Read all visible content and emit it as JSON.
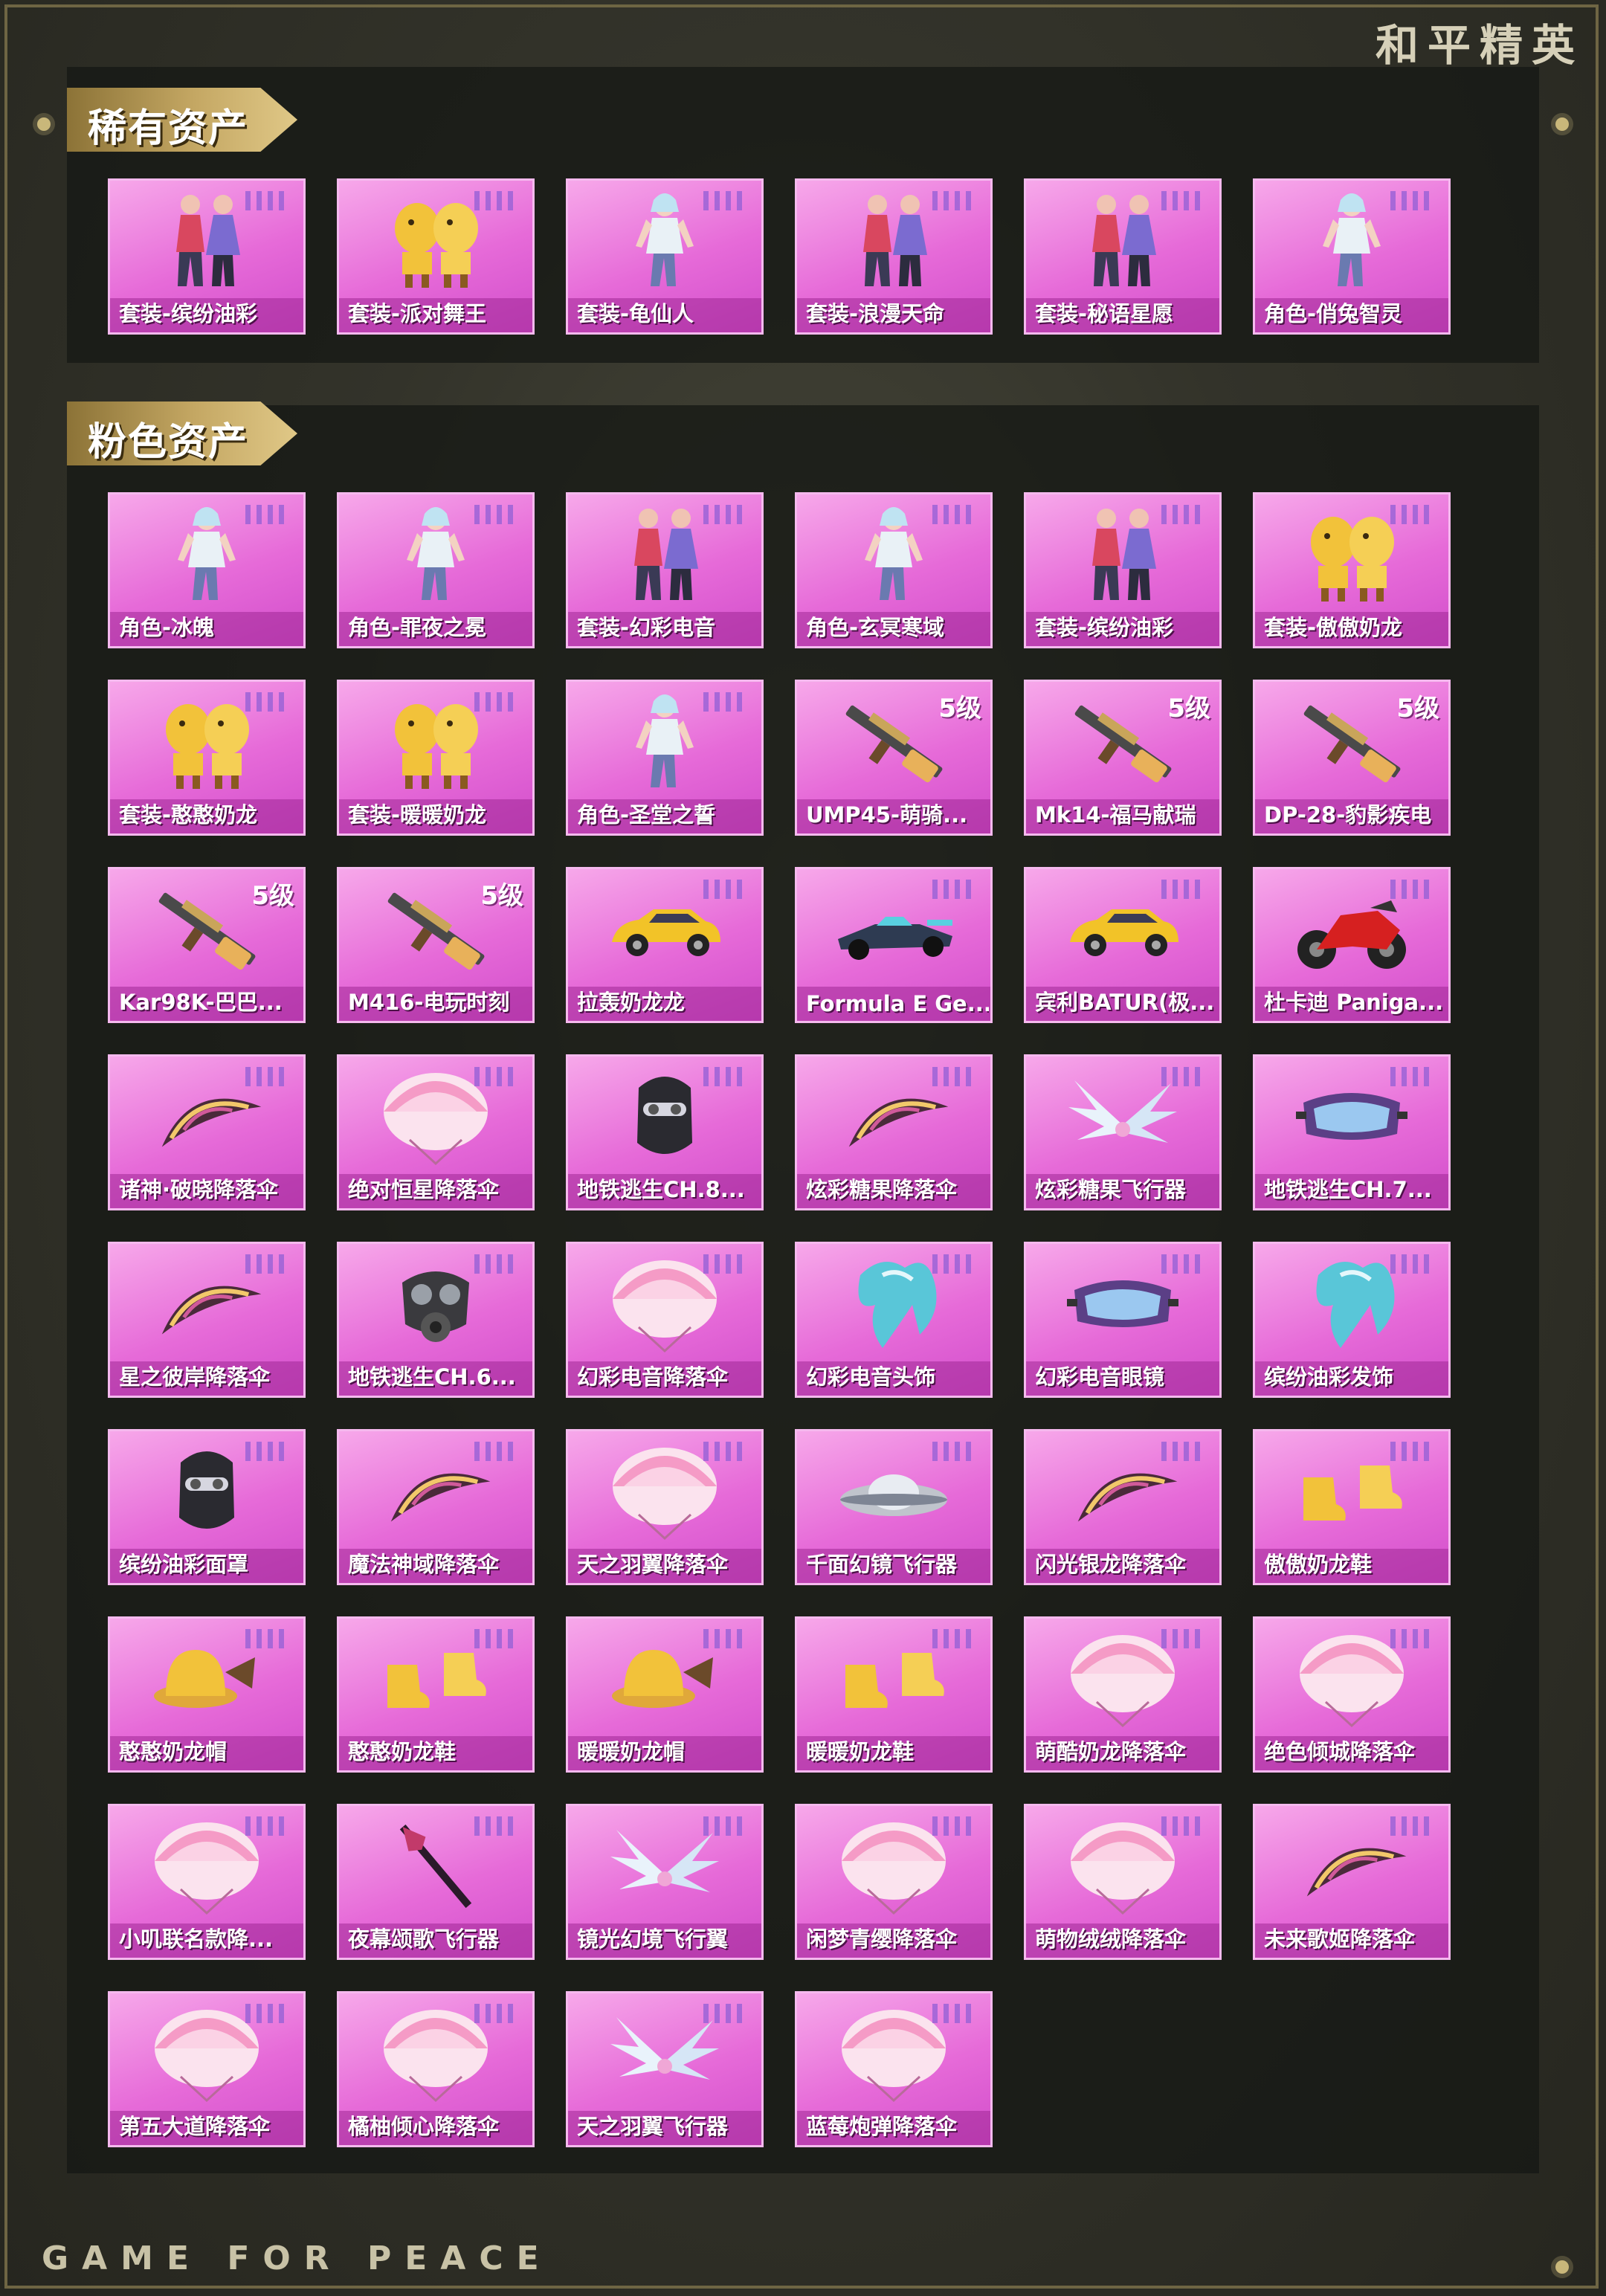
{
  "header": {
    "brand": "和平精英"
  },
  "footer": {
    "brand": "GAME FOR PEACE"
  },
  "colors": {
    "card_bg": "#e66ad8",
    "card_border": "#f5b9ee",
    "section_banner": "#c4a763",
    "panel_bg": "#161814"
  },
  "sections": {
    "rare": {
      "title": "稀有资产",
      "items": [
        {
          "label": "套装-缤纷油彩",
          "icon": "outfit-pair",
          "tier": ""
        },
        {
          "label": "套装-派对舞王",
          "icon": "golden-outfit",
          "tier": ""
        },
        {
          "label": "套装-龟仙人",
          "icon": "character",
          "tier": ""
        },
        {
          "label": "套装-浪漫天命",
          "icon": "outfit-pair",
          "tier": ""
        },
        {
          "label": "套装-秘语星愿",
          "icon": "outfit-pair",
          "tier": ""
        },
        {
          "label": "角色-俏兔智灵",
          "icon": "character",
          "tier": ""
        }
      ]
    },
    "pink": {
      "title": "粉色资产",
      "items": [
        {
          "label": "角色-冰魄",
          "icon": "character",
          "tier": ""
        },
        {
          "label": "角色-罪夜之冕",
          "icon": "character",
          "tier": ""
        },
        {
          "label": "套装-幻彩电音",
          "icon": "outfit-pair",
          "tier": ""
        },
        {
          "label": "角色-玄冥寒域",
          "icon": "character",
          "tier": ""
        },
        {
          "label": "套装-缤纷油彩",
          "icon": "outfit-pair",
          "tier": ""
        },
        {
          "label": "套装-傲傲奶龙",
          "icon": "golden-outfit",
          "tier": ""
        },
        {
          "label": "套装-憨憨奶龙",
          "icon": "golden-outfit",
          "tier": ""
        },
        {
          "label": "套装-暖暖奶龙",
          "icon": "golden-outfit",
          "tier": ""
        },
        {
          "label": "角色-圣堂之誓",
          "icon": "character",
          "tier": ""
        },
        {
          "label": "UMP45-萌骑...",
          "icon": "gun",
          "tier": "5级"
        },
        {
          "label": "Mk14-福马献瑞",
          "icon": "gun",
          "tier": "5级"
        },
        {
          "label": "DP-28-豹影疾电",
          "icon": "gun",
          "tier": "5级"
        },
        {
          "label": "Kar98K-巴巴...",
          "icon": "gun",
          "tier": "5级"
        },
        {
          "label": "M416-电玩时刻",
          "icon": "gun",
          "tier": "5级"
        },
        {
          "label": "拉轰奶龙龙",
          "icon": "car",
          "tier": ""
        },
        {
          "label": "Formula E Ge...",
          "icon": "race-car",
          "tier": ""
        },
        {
          "label": "宾利BATUR(极...",
          "icon": "car",
          "tier": ""
        },
        {
          "label": "杜卡迪 Paniga...",
          "icon": "motorbike",
          "tier": ""
        },
        {
          "label": "诸神·破晓降落伞",
          "icon": "glider",
          "tier": ""
        },
        {
          "label": "绝对恒星降落伞",
          "icon": "parachute",
          "tier": ""
        },
        {
          "label": "地铁逃生CH.8...",
          "icon": "mask",
          "tier": ""
        },
        {
          "label": "炫彩糖果降落伞",
          "icon": "glider",
          "tier": ""
        },
        {
          "label": "炫彩糖果飞行器",
          "icon": "wings",
          "tier": ""
        },
        {
          "label": "地铁逃生CH.7...",
          "icon": "goggles",
          "tier": ""
        },
        {
          "label": "星之彼岸降落伞",
          "icon": "glider",
          "tier": ""
        },
        {
          "label": "地铁逃生CH.6...",
          "icon": "gas-mask",
          "tier": ""
        },
        {
          "label": "幻彩电音降落伞",
          "icon": "parachute",
          "tier": ""
        },
        {
          "label": "幻彩电音头饰",
          "icon": "hair",
          "tier": ""
        },
        {
          "label": "幻彩电音眼镜",
          "icon": "goggles",
          "tier": ""
        },
        {
          "label": "缤纷油彩发饰",
          "icon": "hair",
          "tier": ""
        },
        {
          "label": "缤纷油彩面罩",
          "icon": "mask",
          "tier": ""
        },
        {
          "label": "魔法神域降落伞",
          "icon": "glider",
          "tier": ""
        },
        {
          "label": "天之羽翼降落伞",
          "icon": "parachute",
          "tier": ""
        },
        {
          "label": "千面幻镜飞行器",
          "icon": "ufo",
          "tier": ""
        },
        {
          "label": "闪光银龙降落伞",
          "icon": "glider",
          "tier": ""
        },
        {
          "label": "傲傲奶龙鞋",
          "icon": "shoes",
          "tier": ""
        },
        {
          "label": "憨憨奶龙帽",
          "icon": "hat",
          "tier": ""
        },
        {
          "label": "憨憨奶龙鞋",
          "icon": "shoes",
          "tier": ""
        },
        {
          "label": "暖暖奶龙帽",
          "icon": "hat",
          "tier": ""
        },
        {
          "label": "暖暖奶龙鞋",
          "icon": "shoes",
          "tier": ""
        },
        {
          "label": "萌酷奶龙降落伞",
          "icon": "parachute",
          "tier": ""
        },
        {
          "label": "绝色倾城降落伞",
          "icon": "parachute",
          "tier": ""
        },
        {
          "label": "小叽联名款降...",
          "icon": "parachute",
          "tier": ""
        },
        {
          "label": "夜幕颂歌飞行器",
          "icon": "staff",
          "tier": ""
        },
        {
          "label": "镜光幻境飞行翼",
          "icon": "wings",
          "tier": ""
        },
        {
          "label": "闲梦青缨降落伞",
          "icon": "parachute",
          "tier": ""
        },
        {
          "label": "萌物绒绒降落伞",
          "icon": "parachute",
          "tier": ""
        },
        {
          "label": "未来歌姬降落伞",
          "icon": "glider",
          "tier": ""
        },
        {
          "label": "第五大道降落伞",
          "icon": "parachute",
          "tier": ""
        },
        {
          "label": "橘柚倾心降落伞",
          "icon": "parachute",
          "tier": ""
        },
        {
          "label": "天之羽翼飞行器",
          "icon": "wings",
          "tier": ""
        },
        {
          "label": "蓝莓炮弹降落伞",
          "icon": "parachute",
          "tier": ""
        }
      ]
    }
  }
}
